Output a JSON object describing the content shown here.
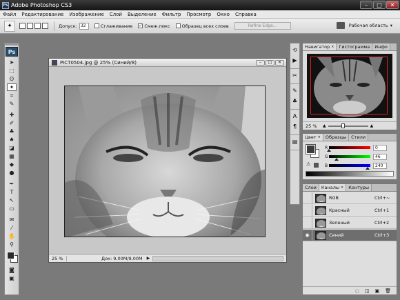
{
  "app": {
    "title": "Adobe Photoshop CS3",
    "logo": "Ps",
    "mini_logo": "Ps"
  },
  "window_buttons": {
    "minimize": "–",
    "maximize": "□",
    "close": "✕"
  },
  "menu": [
    "Файл",
    "Редактирование",
    "Изображение",
    "Слой",
    "Выделение",
    "Фильтр",
    "Просмотр",
    "Окно",
    "Справка"
  ],
  "options": {
    "tolerance_label": "Допуск:",
    "tolerance_value": "32",
    "antialias_label": "Сглаживание",
    "contiguous_label": "Смеж.пикс",
    "contiguous_check": "✓",
    "sample_all_label": "Образец всех слоев",
    "refine_label": "Refine Edge...",
    "workspace_label": "Рабочая область",
    "workspace_arrow": "▾"
  },
  "document": {
    "title": "PICT0504.jpg @ 25% (Синий/8)",
    "zoom": "25 %",
    "doc_size": "Док: 9,00M/9,00M",
    "status_arrow": "▶",
    "btn_min": "–",
    "btn_max": "□",
    "btn_close": "✕"
  },
  "navigator": {
    "tabs": [
      "Навигатор",
      "Гистограмма",
      "Инфо"
    ],
    "close_mark": "×",
    "zoom": "25 %",
    "zoom_out": "▲",
    "zoom_in": "▲",
    "zoom_fraction": 0.33
  },
  "color_panel": {
    "tabs": [
      "Цвет",
      "Образцы",
      "Стили"
    ],
    "close_mark": "×",
    "channels": [
      {
        "label": "R",
        "value": "0",
        "fraction": 0.0,
        "gradient": [
          "#000000",
          "#ff0000"
        ]
      },
      {
        "label": "G",
        "value": "46",
        "fraction": 0.18,
        "gradient": [
          "#000000",
          "#00ff00"
        ]
      },
      {
        "label": "B",
        "value": "240",
        "fraction": 0.94,
        "gradient": [
          "#000000",
          "#0000ff"
        ]
      }
    ],
    "warning_glyph": "⚠"
  },
  "channels_panel": {
    "tabs": [
      "Слои",
      "Каналы",
      "Контуры"
    ],
    "close_mark": "×",
    "eye_glyph": "◉",
    "rows": [
      {
        "name": "RGB",
        "shortcut": "Ctrl+~",
        "visible": false,
        "selected": false
      },
      {
        "name": "Красный",
        "shortcut": "Ctrl+1",
        "visible": false,
        "selected": false
      },
      {
        "name": "Зеленый",
        "shortcut": "Ctrl+2",
        "visible": false,
        "selected": false
      },
      {
        "name": "Синий",
        "shortcut": "Ctrl+3",
        "visible": true,
        "selected": true
      }
    ],
    "footer_icons": [
      "◌",
      "◫",
      "▣",
      "🗑"
    ]
  },
  "colors": {
    "title_bar": "#1e1e1e",
    "workspace": "#7a7a7a",
    "selection": "#6e6e6e",
    "nav_view_box": "#dd2222"
  }
}
